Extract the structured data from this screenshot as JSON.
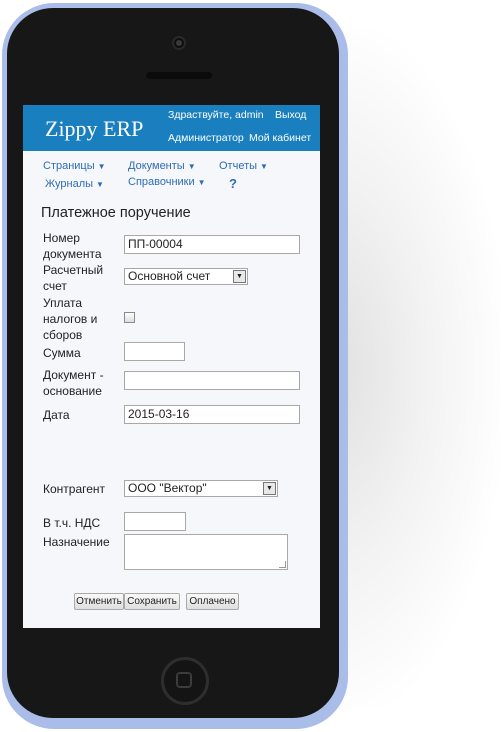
{
  "header": {
    "brand": "Zippy ERP",
    "greeting": "Здраствуйте, admin",
    "logout": "Выход",
    "role": "Администратор",
    "cabinet": "Мой кабинет"
  },
  "nav": {
    "pages": "Страницы",
    "documents": "Документы",
    "reports": "Отчеты",
    "journals": "Журналы",
    "directories": "Справочники",
    "help": "?"
  },
  "form": {
    "title": "Платежное поручение",
    "doc_number_label_1": "Номер",
    "doc_number_label_2": "документа",
    "doc_number_value": "ПП-00004",
    "account_label_1": "Расчетный",
    "account_label_2": "счет",
    "account_value": "Основной счет",
    "taxes_label_1": "Уплата",
    "taxes_label_2": "налогов и",
    "taxes_label_3": "сборов",
    "taxes_checked": false,
    "amount_label": "Сумма",
    "amount_value": "",
    "basis_label_1": "Документ -",
    "basis_label_2": "основание",
    "basis_value": "",
    "date_label": "Дата",
    "date_value": "2015-03-16",
    "counterparty_label": "Контрагент",
    "counterparty_value": "ООО \"Вектор\"",
    "vat_label": "В т.ч. НДС",
    "vat_value": "",
    "purpose_label": "Назначение",
    "purpose_value": ""
  },
  "buttons": {
    "cancel": "Отменить",
    "save": "Сохранить",
    "paid": "Оплачено"
  },
  "colors": {
    "header_bg": "#1a7fbf",
    "link": "#2f6db3",
    "phone_body": "#171717",
    "phone_frame": "#a9bde8"
  },
  "icons": {
    "caret": "caret-down-icon",
    "select_arrow": "select-arrow-icon"
  }
}
